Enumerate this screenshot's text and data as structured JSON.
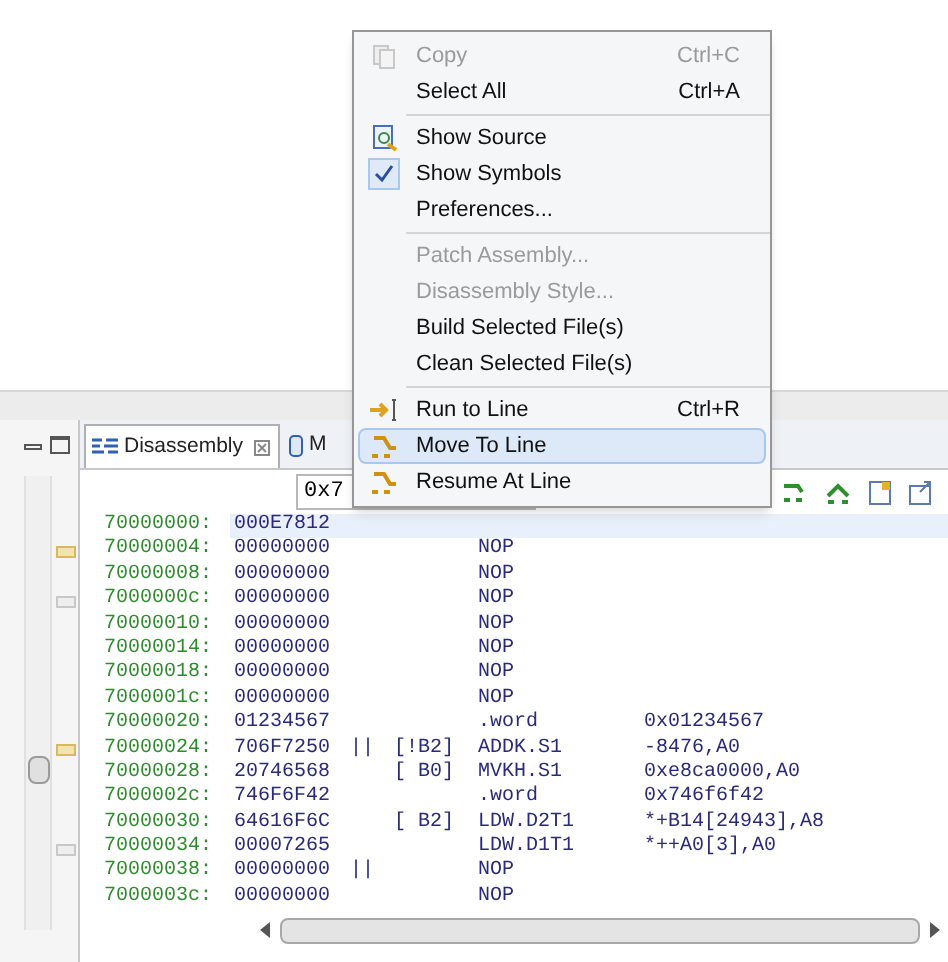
{
  "tabs": [
    {
      "label": "Disassembly",
      "selected": true,
      "kind": "disassembly"
    },
    {
      "label": "M",
      "selected": false,
      "kind": "memory"
    }
  ],
  "address_field": {
    "value": "0x7"
  },
  "rows": [
    {
      "address": "70000000:",
      "opcode": "000E7812",
      "selected": true
    },
    {
      "address": "70000004:",
      "opcode": "00000000",
      "mnemonic": "NOP",
      "selected": false
    },
    {
      "address": "70000008:",
      "opcode": "00000000",
      "mnemonic": "NOP",
      "selected": false
    },
    {
      "address": "7000000c:",
      "opcode": "00000000",
      "mnemonic": "NOP",
      "selected": false
    },
    {
      "address": "70000010:",
      "opcode": "00000000",
      "mnemonic": "NOP",
      "selected": false
    },
    {
      "address": "70000014:",
      "opcode": "00000000",
      "mnemonic": "NOP",
      "selected": false
    },
    {
      "address": "70000018:",
      "opcode": "00000000",
      "mnemonic": "NOP",
      "selected": false
    },
    {
      "address": "7000001c:",
      "opcode": "00000000",
      "mnemonic": "NOP",
      "selected": false
    },
    {
      "address": "70000020:",
      "opcode": "01234567",
      "mnemonic": ".word",
      "operands": "0x01234567",
      "selected": false
    },
    {
      "address": "70000024:",
      "opcode": "706F7250",
      "parallel": "||",
      "predicate": "[!B2]",
      "mnemonic": "ADDK.S1",
      "operands": "-8476,A0",
      "selected": false
    },
    {
      "address": "70000028:",
      "opcode": "20746568",
      "predicate": "[ B0]",
      "mnemonic": "MVKH.S1",
      "operands": "0xe8ca0000,A0",
      "selected": false
    },
    {
      "address": "7000002c:",
      "opcode": "746F6F42",
      "mnemonic": ".word",
      "operands": "0x746f6f42",
      "selected": false
    },
    {
      "address": "70000030:",
      "opcode": "64616F6C",
      "predicate": "[ B2]",
      "mnemonic": "LDW.D2T1",
      "operands": "*+B14[24943],A8",
      "selected": false
    },
    {
      "address": "70000034:",
      "opcode": "00007265",
      "mnemonic": "LDW.D1T1",
      "operands": "*++A0[3],A0",
      "selected": false
    },
    {
      "address": "70000038:",
      "opcode": "00000000",
      "parallel": "||",
      "mnemonic": "NOP",
      "selected": false
    },
    {
      "address": "7000003c:",
      "opcode": "00000000",
      "mnemonic": "NOP",
      "selected": false
    }
  ],
  "context_menu": [
    {
      "kind": "copy",
      "label": "Copy",
      "shortcut": "Ctrl+C",
      "disabled": true,
      "selected": false
    },
    {
      "kind": "plain",
      "label": "Select All",
      "shortcut": "Ctrl+A",
      "disabled": false,
      "selected": false
    },
    {
      "kind": "separator"
    },
    {
      "kind": "source",
      "label": "Show Source",
      "disabled": false,
      "selected": false
    },
    {
      "kind": "toggle",
      "label": "Show Symbols",
      "disabled": false,
      "checked": true,
      "selected": false
    },
    {
      "kind": "plain",
      "label": "Preferences...",
      "disabled": false,
      "selected": false
    },
    {
      "kind": "separator"
    },
    {
      "kind": "plain",
      "label": "Patch Assembly...",
      "disabled": true,
      "selected": false
    },
    {
      "kind": "plain",
      "label": "Disassembly Style...",
      "disabled": true,
      "selected": false
    },
    {
      "kind": "plain",
      "label": "Build Selected File(s)",
      "disabled": false,
      "selected": false
    },
    {
      "kind": "plain",
      "label": "Clean Selected File(s)",
      "disabled": false,
      "selected": false
    },
    {
      "kind": "separator"
    },
    {
      "kind": "run",
      "label": "Run to Line",
      "shortcut": "Ctrl+R",
      "disabled": false,
      "selected": false
    },
    {
      "kind": "move",
      "label": "Move To Line",
      "disabled": false,
      "selected": true
    },
    {
      "kind": "move",
      "label": "Resume At Line",
      "disabled": false,
      "selected": false
    }
  ]
}
